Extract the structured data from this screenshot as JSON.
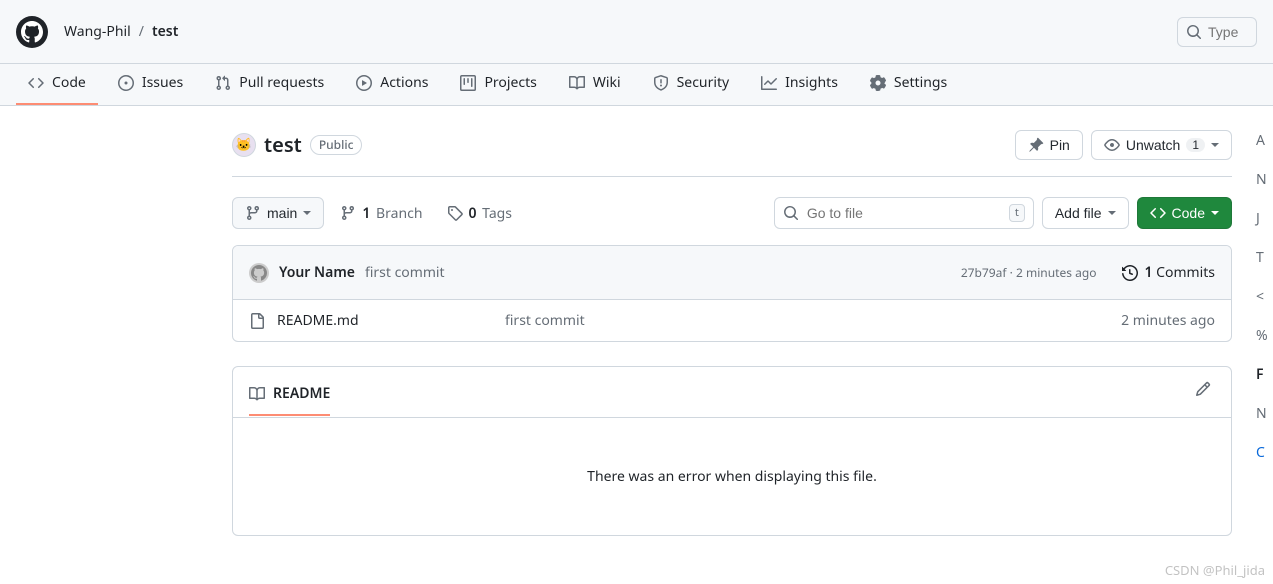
{
  "header": {
    "owner": "Wang-Phil",
    "repo": "test",
    "search_placeholder": "Type"
  },
  "nav": {
    "items": [
      {
        "label": "Code"
      },
      {
        "label": "Issues"
      },
      {
        "label": "Pull requests"
      },
      {
        "label": "Actions"
      },
      {
        "label": "Projects"
      },
      {
        "label": "Wiki"
      },
      {
        "label": "Security"
      },
      {
        "label": "Insights"
      },
      {
        "label": "Settings"
      }
    ]
  },
  "repo": {
    "name": "test",
    "visibility": "Public",
    "pin_label": "Pin",
    "unwatch_label": "Unwatch",
    "unwatch_count": "1"
  },
  "branch": {
    "name": "main",
    "branches_count": "1",
    "branches_label": "Branch",
    "tags_count": "0",
    "tags_label": "Tags"
  },
  "toolbar": {
    "gotofile_placeholder": "Go to file",
    "gotofile_key": "t",
    "addfile_label": "Add file",
    "code_label": "Code"
  },
  "latest_commit": {
    "author": "Your Name",
    "message": "first commit",
    "sha": "27b79af",
    "time": "2 minutes ago",
    "commits_count": "1",
    "commits_label": "Commits"
  },
  "files": [
    {
      "name": "README.md",
      "commit": "first commit",
      "time": "2 minutes ago"
    }
  ],
  "readme": {
    "tab_label": "README",
    "error_text": "There was an error when displaying this file."
  },
  "watermark": "CSDN @Phil_jida"
}
